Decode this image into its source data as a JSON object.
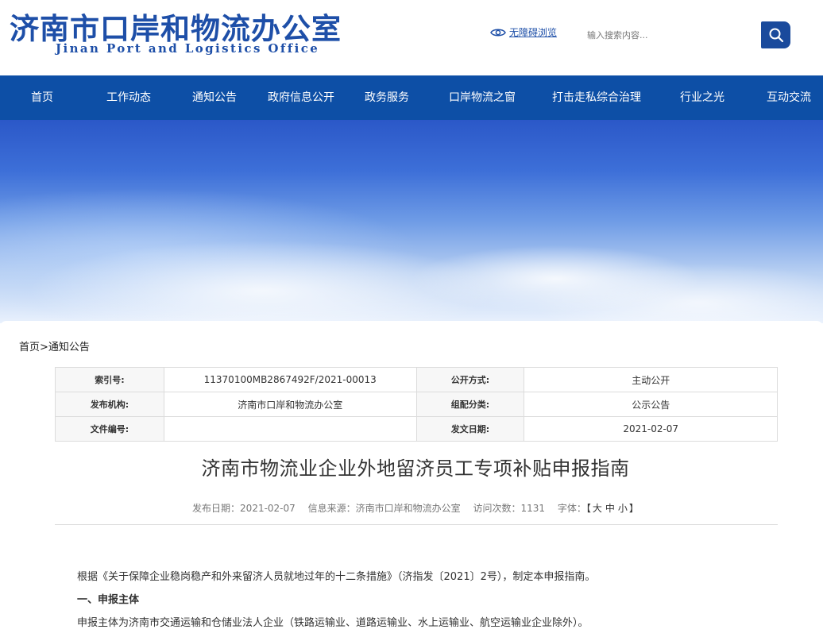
{
  "header": {
    "logo_cn": "济南市口岸和物流办公室",
    "logo_en": "Jinan Port and Logistics Office",
    "accessibility_label": "无障碍浏览",
    "search_placeholder": "输入搜索内容...",
    "search_icon": "search-icon",
    "accessibility_icon": "eye-icon"
  },
  "nav": {
    "items": [
      "首页",
      "工作动态",
      "通知公告",
      "政府信息公开",
      "政务服务",
      "口岸物流之窗",
      "打击走私综合治理",
      "行业之光",
      "互动交流"
    ]
  },
  "breadcrumb": {
    "home": "首页",
    "separator": ">",
    "current": "通知公告"
  },
  "meta": {
    "index_label": "索引号:",
    "index_value": "11370100MB2867492F/2021-00013",
    "open_label": "公开方式:",
    "open_value": "主动公开",
    "publisher_label": "发布机构:",
    "publisher_value": "济南市口岸和物流办公室",
    "category_label": "组配分类:",
    "category_value": "公示公告",
    "doc_no_label": "文件编号:",
    "doc_no_value": "",
    "date_label": "发文日期:",
    "date_value": "2021-02-07"
  },
  "article": {
    "title": "济南市物流业企业外地留济员工专项补贴申报指南",
    "publish_date": "发布日期：2021-02-07",
    "source": "信息来源：济南市口岸和物流办公室",
    "visits": "访问次数：1131",
    "font_label": "字体：",
    "font_open": "【",
    "font_large": "大",
    "font_medium": "中",
    "font_small": "小",
    "font_close": "】",
    "paragraphs": [
      "根据《关于保障企业稳岗稳产和外来留济人员就地过年的十二条措施》（济指发〔2021〕2号），制定本申报指南。",
      "一、申报主体",
      "申报主体为济南市交通运输和仓储业法人企业（铁路运输业、道路运输业、水上运输业、航空运输业企业除外）。"
    ]
  },
  "colors": {
    "brand_blue": "#1e4fa8",
    "nav_blue": "#0d4fa6",
    "search_button": "#1a4a9c"
  }
}
